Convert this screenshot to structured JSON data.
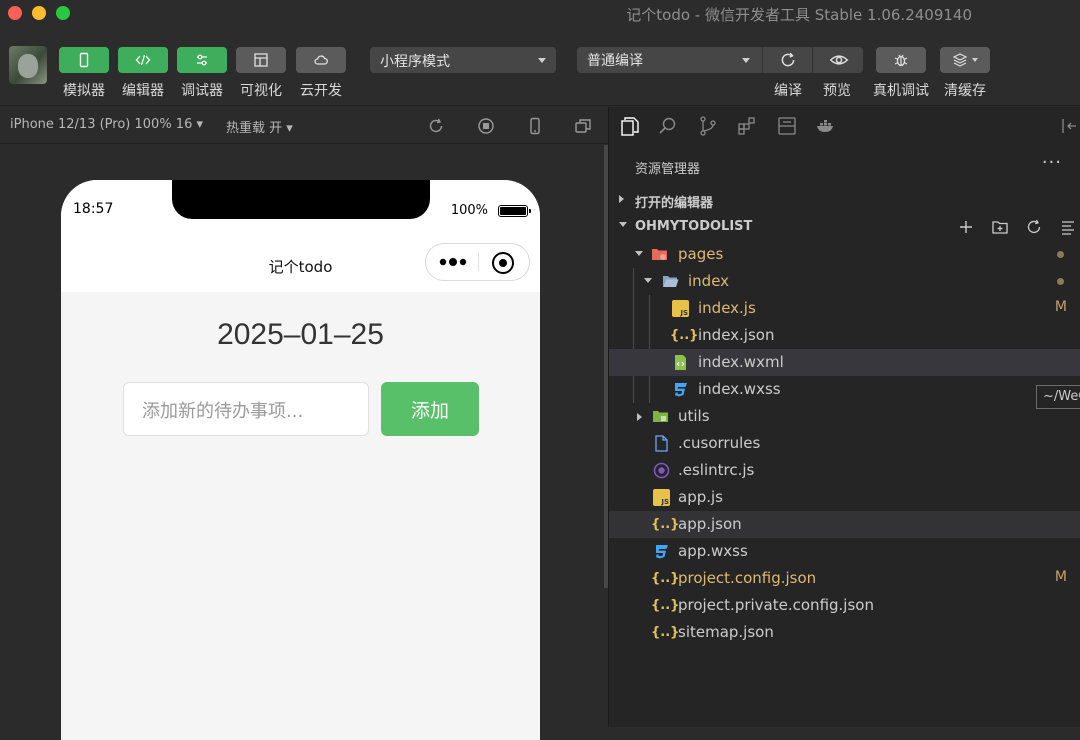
{
  "window": {
    "title": "记个todo - 微信开发者工具 Stable 1.06.2409140"
  },
  "toolbar": {
    "simulator_label": "模拟器",
    "editor_label": "编辑器",
    "debugger_label": "调试器",
    "visual_label": "可视化",
    "cloud_label": "云开发",
    "mode_select": "小程序模式",
    "compile_select": "普通编译",
    "compile_label": "编译",
    "preview_label": "预览",
    "device_debug_label": "真机调试",
    "clear_cache_label": "清缓存",
    "accent_color": "#3fae5c"
  },
  "simulator_bar": {
    "device": "iPhone 12/13 (Pro) 100% 16 ▾",
    "hot_reload": "热重载 开 ▾"
  },
  "phone": {
    "status_time": "18:57",
    "battery": "100%",
    "nav_title": "记个todo",
    "date": "2025–01–25",
    "input_placeholder": "添加新的待办事项...",
    "add_button": "添加",
    "button_color": "#57c068"
  },
  "explorer": {
    "title": "资源管理器",
    "more": "···",
    "open_editors": "打开的编辑器",
    "project": "OHMYTODOLIST",
    "items": [
      {
        "name": "pages",
        "status": ""
      },
      {
        "name": "index",
        "status": ""
      },
      {
        "name": "index.js",
        "status": "M"
      },
      {
        "name": "index.json",
        "status": ""
      },
      {
        "name": "index.wxml",
        "status": ""
      },
      {
        "name": "index.wxss",
        "status": ""
      },
      {
        "name": "utils",
        "status": ""
      },
      {
        "name": ".cusorrules",
        "status": ""
      },
      {
        "name": ".eslintrc.js",
        "status": ""
      },
      {
        "name": "app.js",
        "status": ""
      },
      {
        "name": "app.json",
        "status": ""
      },
      {
        "name": "app.wxss",
        "status": ""
      },
      {
        "name": "project.config.json",
        "status": "M"
      },
      {
        "name": "project.private.config.json",
        "status": ""
      },
      {
        "name": "sitemap.json",
        "status": ""
      }
    ],
    "tooltip": "~/WeC"
  }
}
